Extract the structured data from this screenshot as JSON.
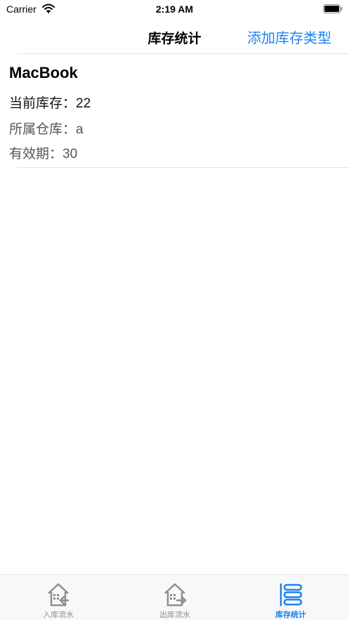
{
  "status_bar": {
    "carrier": "Carrier",
    "time": "2:19 AM"
  },
  "nav": {
    "title": "库存统计",
    "action": "添加库存类型"
  },
  "inventory": [
    {
      "name": "MacBook",
      "stock": "当前库存：22",
      "warehouse": "所属仓库：a",
      "expiry": "有效期：30"
    }
  ],
  "tabs": [
    {
      "label": "入库流水",
      "icon": "warehouse-in-icon",
      "active": false
    },
    {
      "label": "出库流水",
      "icon": "warehouse-out-icon",
      "active": false
    },
    {
      "label": "库存统计",
      "icon": "stock-list-icon",
      "active": true
    }
  ],
  "colors": {
    "accent": "#1a83ee",
    "inactive": "#8e8e93"
  }
}
